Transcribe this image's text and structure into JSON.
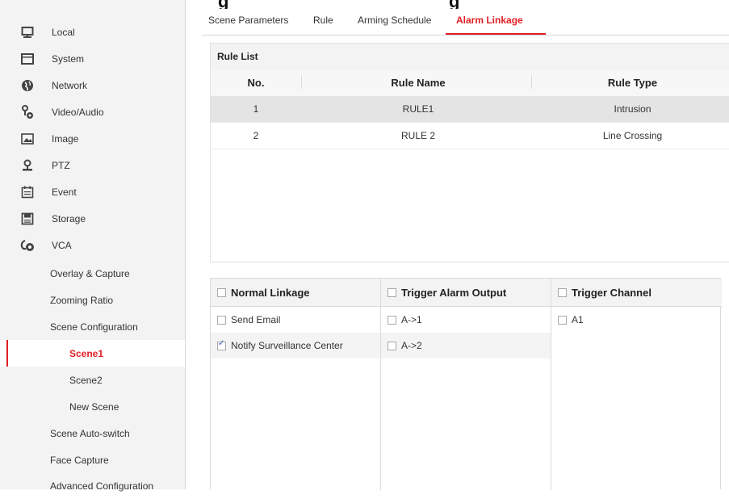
{
  "top_heading": {
    "left": "g",
    "right": "g"
  },
  "sidebar": {
    "items": [
      {
        "label": "Local",
        "icon": "monitor-icon"
      },
      {
        "label": "System",
        "icon": "system-icon"
      },
      {
        "label": "Network",
        "icon": "network-globe-icon"
      },
      {
        "label": "Video/Audio",
        "icon": "video-audio-icon"
      },
      {
        "label": "Image",
        "icon": "image-icon"
      },
      {
        "label": "PTZ",
        "icon": "ptz-icon"
      },
      {
        "label": "Event",
        "icon": "event-calendar-icon"
      },
      {
        "label": "Storage",
        "icon": "storage-icon"
      },
      {
        "label": "VCA",
        "icon": "vca-icon"
      }
    ],
    "vca_sub": [
      "Overlay & Capture",
      "Zooming Ratio",
      "Scene Configuration"
    ],
    "scenes": [
      "Scene1",
      "Scene2",
      "New Scene"
    ],
    "vca_sub_after": [
      "Scene Auto-switch",
      "Face Capture",
      "Advanced Configuration"
    ]
  },
  "tabs": [
    "Scene Parameters",
    "Rule",
    "Arming Schedule",
    "Alarm Linkage"
  ],
  "rule_list": {
    "title": "Rule List",
    "headers": {
      "no": "No.",
      "name": "Rule Name",
      "type": "Rule Type"
    },
    "rows": [
      {
        "no": "1",
        "name": "RULE1",
        "type": "Intrusion"
      },
      {
        "no": "2",
        "name": "RULE 2",
        "type": "Line Crossing"
      }
    ]
  },
  "linkage": {
    "normal": {
      "header": "Normal Linkage",
      "items": [
        {
          "label": "Send Email",
          "checked": false
        },
        {
          "label": "Notify Surveillance Center",
          "checked": true
        }
      ]
    },
    "alarm_output": {
      "header": "Trigger Alarm Output",
      "items": [
        {
          "label": "A->1",
          "checked": false
        },
        {
          "label": "A->2",
          "checked": false
        }
      ]
    },
    "channel": {
      "header": "Trigger Channel",
      "items": [
        {
          "label": "A1",
          "checked": false
        }
      ]
    }
  },
  "colors": {
    "accent": "#e21d25",
    "sidebar_bg": "#f3f3f3",
    "selected_row": "#e4e4e4"
  }
}
